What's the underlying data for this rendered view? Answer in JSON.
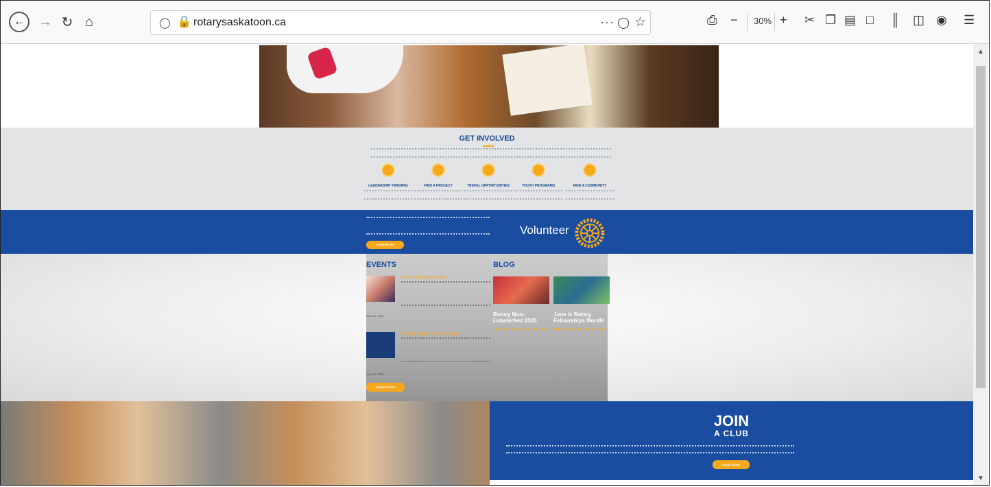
{
  "browser": {
    "url": "rotarysaskatoon.ca",
    "zoom": "30%",
    "more_glyph": "···"
  },
  "page": {
    "get_involved": {
      "title": "GET INVOLVED",
      "items": [
        {
          "label": "LEADERSHIP TRAINING"
        },
        {
          "label": "FIND A PROJECT"
        },
        {
          "label": "TRAVEL OPPORTUNITIES"
        },
        {
          "label": "YOUTH PROGRAMS"
        },
        {
          "label": "FIND A COMMUNITY"
        }
      ]
    },
    "volunteer": {
      "heading": "Volunteer",
      "button": "LEARN MORE"
    },
    "events": {
      "title": "EVENTS",
      "items": [
        {
          "title": "Family Fun Scavenger Hunt",
          "date": "June 17, 2020"
        },
        {
          "title": "The 2020 Rotary Virtual Convention",
          "date": "June 10, 2020"
        }
      ],
      "button": "MORE EVENTS"
    },
    "blog": {
      "title": "BLOG",
      "posts": [
        {
          "title": "Rotary Non-Lobsterfest 2020"
        },
        {
          "title": "June is Rotary Fellowships Month!"
        }
      ]
    },
    "join": {
      "line1": "JOIN",
      "line2": "A CLUB",
      "button": "LEARN MORE"
    }
  },
  "colors": {
    "rotary_blue": "#1a4d9f",
    "rotary_gold": "#f7a81b"
  }
}
